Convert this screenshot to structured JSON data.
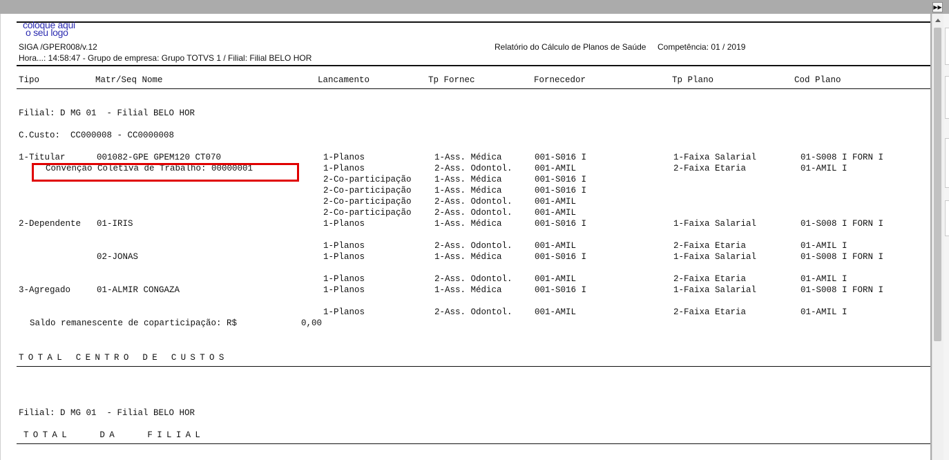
{
  "report": {
    "logo_line1": "coloque aqui",
    "logo_line2": "o seu logo",
    "program": "SIGA /GPER008/v.12",
    "title": "Relatório do Cálculo de Planos de Saúde",
    "competencia": "Competência: 01 / 2019",
    "hora_line": "Hora...: 14:58:47 - Grupo de empresa: Grupo TOTVS 1 / Filial: Filial BELO HOR"
  },
  "columns": {
    "tipo": "Tipo",
    "matr": "Matr/Seq Nome",
    "lancamento": "Lancamento",
    "tp_fornec": "Tp Fornec",
    "fornecedor": "Fornecedor",
    "tp_plano": "Tp Plano",
    "cod_plano": "Cod Plano"
  },
  "section1": {
    "filial": "Filial: D MG 01  - Filial BELO HOR",
    "ccusto": "C.Custo:  CC000008 - CC0000008"
  },
  "rows": [
    {
      "tipo": "1-Titular",
      "matr": "001082-GPE GPEM120 CT070",
      "lanc": "1-Planos",
      "tpf": "1-Ass. Médica",
      "forn": "001-S016 I",
      "tpp": "1-Faixa Salarial",
      "cod": "01-S008 I FORN I"
    },
    {
      "tipo": "",
      "matr": "",
      "lanc": "1-Planos",
      "tpf": "2-Ass. Odontol.",
      "forn": "001-AMIL",
      "tpp": "2-Faixa Etaria",
      "cod": "01-AMIL I"
    },
    {
      "tipo": "",
      "matr": "",
      "lanc": "2-Co-participação",
      "tpf": "1-Ass. Médica",
      "forn": "001-S016 I",
      "tpp": "",
      "cod": ""
    },
    {
      "tipo": "",
      "matr": "",
      "lanc": "2-Co-participação",
      "tpf": "1-Ass. Médica",
      "forn": "001-S016 I",
      "tpp": "",
      "cod": ""
    },
    {
      "tipo": "",
      "matr": "",
      "lanc": "2-Co-participação",
      "tpf": "2-Ass. Odontol.",
      "forn": "001-AMIL",
      "tpp": "",
      "cod": ""
    },
    {
      "tipo": "",
      "matr": "",
      "lanc": "2-Co-participação",
      "tpf": "2-Ass. Odontol.",
      "forn": "001-AMIL",
      "tpp": "",
      "cod": ""
    },
    {
      "tipo": "2-Dependente",
      "matr": "01-IRIS",
      "lanc": "1-Planos",
      "tpf": "1-Ass. Médica",
      "forn": "001-S016 I",
      "tpp": "1-Faixa Salarial",
      "cod": "01-S008 I FORN I"
    },
    {
      "tipo": "",
      "matr": "",
      "lanc": "1-Planos",
      "tpf": "2-Ass. Odontol.",
      "forn": "001-AMIL",
      "tpp": "2-Faixa Etaria",
      "cod": "01-AMIL I"
    },
    {
      "tipo": "",
      "matr": "02-JONAS",
      "lanc": "1-Planos",
      "tpf": "1-Ass. Médica",
      "forn": "001-S016 I",
      "tpp": "1-Faixa Salarial",
      "cod": "01-S008 I FORN I"
    },
    {
      "tipo": "",
      "matr": "",
      "lanc": "1-Planos",
      "tpf": "2-Ass. Odontol.",
      "forn": "001-AMIL",
      "tpp": "2-Faixa Etaria",
      "cod": "01-AMIL I"
    },
    {
      "tipo": "3-Agregado",
      "matr": "01-ALMIR CONGAZA",
      "lanc": "1-Planos",
      "tpf": "1-Ass. Médica",
      "forn": "001-S016 I",
      "tpp": "1-Faixa Salarial",
      "cod": "01-S008 I FORN I"
    },
    {
      "tipo": "",
      "matr": "",
      "lanc": "1-Planos",
      "tpf": "2-Ass. Odontol.",
      "forn": "001-AMIL",
      "tpp": "2-Faixa Etaria",
      "cod": "01-AMIL I"
    }
  ],
  "convencao": "Convenção Coletiva de Trabalho: 00000001",
  "saldo_label": "Saldo remanescente de coparticipação: R$",
  "saldo_value": "0,00",
  "total_cc": "TOTAL CENTRO DE CUSTOS",
  "section2": {
    "filial": "Filial: D MG 01  - Filial BELO HOR"
  },
  "total_filial": "TOTAL   DA   FILIAL",
  "colors": {
    "highlight": "#e00000",
    "logo": "#2b2bb0"
  },
  "icons": {
    "expand": "double-chevron-right-icon",
    "scroll_up": "triangle-up-icon"
  }
}
